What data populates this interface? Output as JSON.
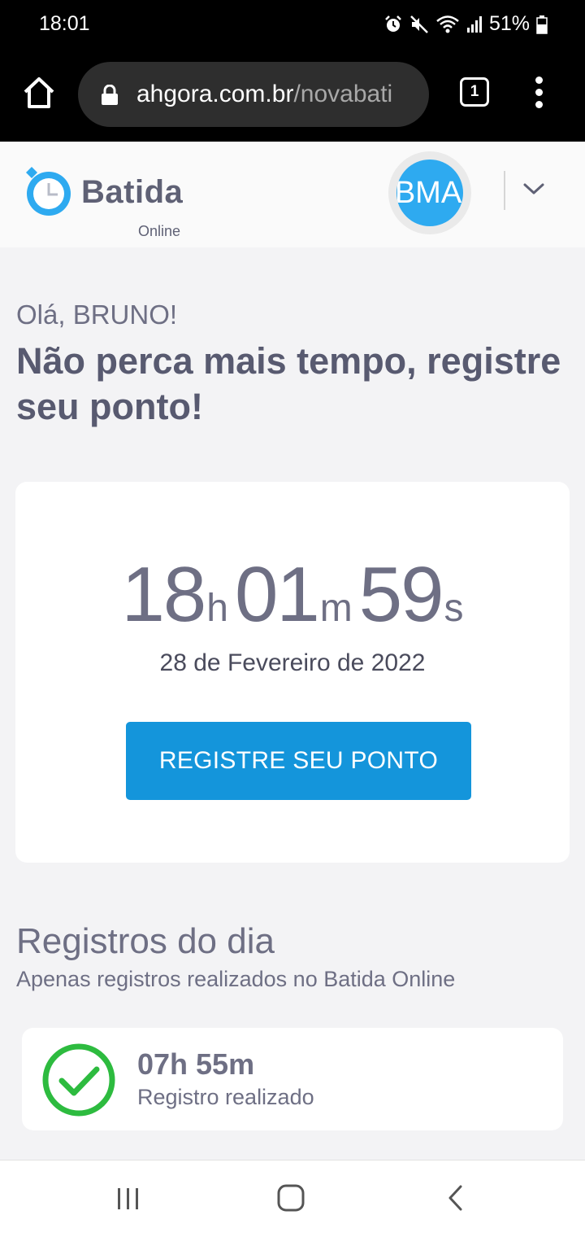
{
  "status_bar": {
    "time": "18:01",
    "battery": "51%",
    "icons": [
      "alarm-icon",
      "mute-icon",
      "wifi-icon",
      "signal-icon",
      "battery-icon"
    ]
  },
  "browser": {
    "url_host": "ahgora.com.br",
    "url_path": "/novabati",
    "tab_count": "1"
  },
  "header": {
    "logo_text": "Batida",
    "logo_sub": "Online",
    "avatar_initials": "BMA"
  },
  "greeting": {
    "hello": "Olá, BRUNO!",
    "headline": "Não perca mais tempo, registre seu ponto!"
  },
  "clock": {
    "hours": "18",
    "hours_unit": "h",
    "minutes": "01",
    "minutes_unit": "m",
    "seconds": "59",
    "seconds_unit": "s",
    "date": "28 de Fevereiro de 2022",
    "button_label": "REGISTRE SEU PONTO"
  },
  "records": {
    "title": "Registros do dia",
    "subtitle": "Apenas registros realizados no Batida Online",
    "items": [
      {
        "time": "07h 55m",
        "status": "Registro realizado"
      }
    ]
  },
  "colors": {
    "primary_blue": "#1495db",
    "avatar_blue": "#2eaaf0",
    "success_green": "#2dbb3f",
    "text_gray": "#6e6f84"
  }
}
